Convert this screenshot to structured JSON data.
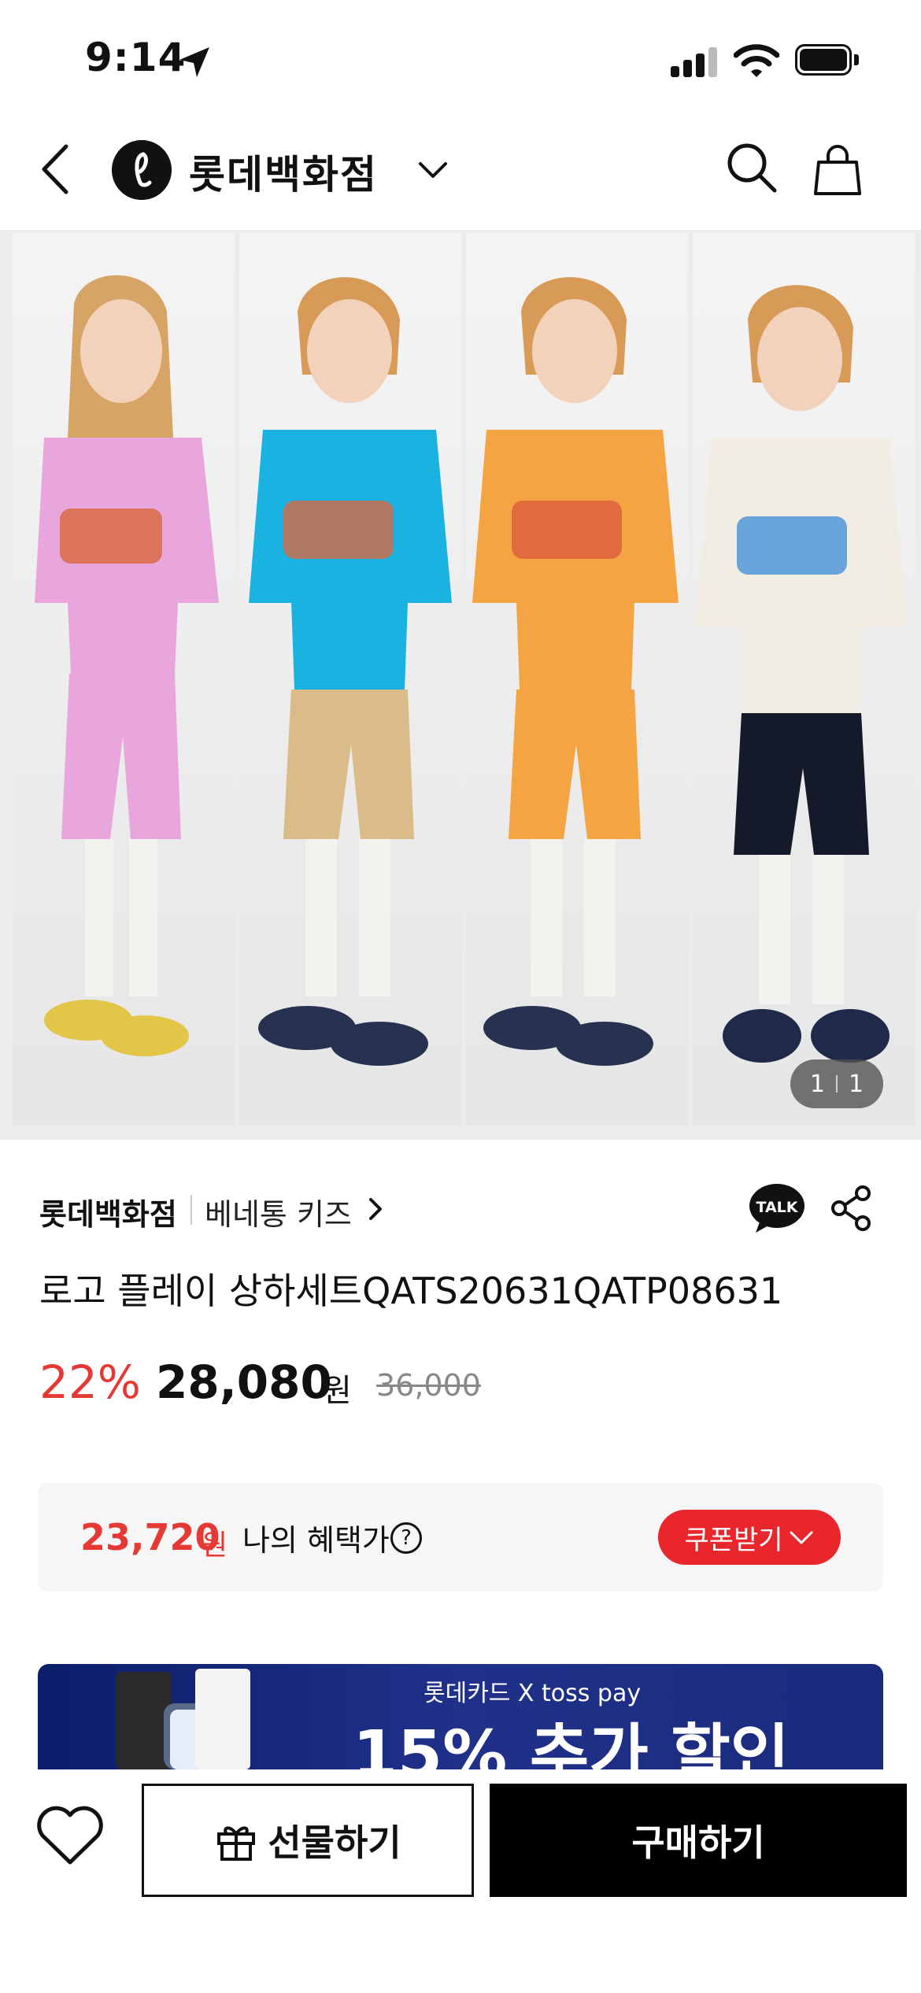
{
  "status_bar": {
    "time": "9:14"
  },
  "header": {
    "brand": "롯데백화점"
  },
  "gallery": {
    "current": "1",
    "total": "1"
  },
  "product": {
    "seller": "롯데백화점",
    "brand_link": "베네통 키즈",
    "title": "로고 플레이 상하세트QATS20631QATP08631",
    "discount": "22%",
    "price": "28,080",
    "price_unit": "원",
    "original_price": "36,000"
  },
  "benefit": {
    "price": "23,720",
    "unit": "원",
    "label": "나의 혜택가",
    "coupon_label": "쿠폰받기"
  },
  "banner": {
    "brand_line": "롯데카드 X toss pay",
    "headline": "15% 추가 할인"
  },
  "bottom_bar": {
    "gift_label": "선물하기",
    "buy_label": "구매하기"
  },
  "colors": {
    "accent_red": "#e53935",
    "coupon_red": "#e8262c",
    "banner_navy": "#1a2a7c"
  },
  "icons": [
    "location-arrow-icon",
    "signal-icon",
    "wifi-icon",
    "battery-icon",
    "back-icon",
    "brand-logo",
    "chevron-down-icon",
    "search-icon",
    "shopping-bag-icon",
    "chevron-right-icon",
    "kakao-talk-icon",
    "share-icon",
    "help-icon",
    "heart-icon",
    "gift-icon"
  ]
}
